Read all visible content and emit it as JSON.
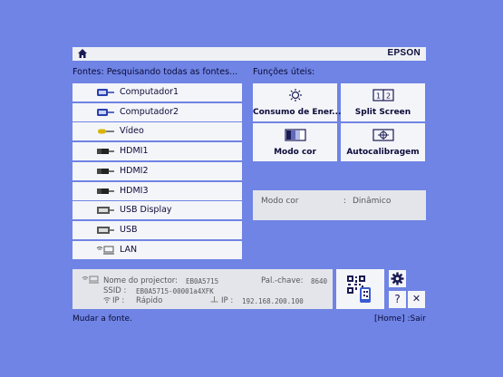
{
  "topbar": {
    "home_icon": "home-icon",
    "brand": "EPSON"
  },
  "sources_header": "Fontes:  Pesquisando todas as fontes...",
  "functions_header": "Funções úteis:",
  "sources": [
    {
      "label": "Computador1",
      "icon": "computer-input-icon"
    },
    {
      "label": "Computador2",
      "icon": "computer-input-icon"
    },
    {
      "label": "Vídeo",
      "icon": "video-input-icon"
    },
    {
      "label": "HDMI1",
      "icon": "hdmi-icon"
    },
    {
      "label": "HDMI2",
      "icon": "hdmi-icon"
    },
    {
      "label": "HDMI3",
      "icon": "hdmi-icon"
    },
    {
      "label": "USB Display",
      "icon": "usb-display-icon"
    },
    {
      "label": "USB",
      "icon": "usb-icon"
    },
    {
      "label": "LAN",
      "icon": "lan-icon"
    }
  ],
  "functions": [
    {
      "label": "Consumo de Ener...",
      "icon": "power-consumption-icon"
    },
    {
      "label": "Split Screen",
      "icon": "split-screen-icon"
    },
    {
      "label": "Modo cor",
      "icon": "color-mode-icon"
    },
    {
      "label": "Autocalibragem",
      "icon": "auto-calibration-icon"
    }
  ],
  "color_mode": {
    "label": "Modo cor",
    "separator": ":",
    "value": "Dinâmico"
  },
  "network": {
    "projector_name_label": "Nome do projector:",
    "projector_name": "EB0A5715",
    "keyword_label": "Pal.-chave:",
    "keyword": "8640",
    "ssid_label": "SSID :",
    "ssid": "EB0A5715-00001a4XFK",
    "ip_mode_label": "IP :",
    "ip_mode": "Rápido",
    "ip_label": "IP :",
    "ip": "192.168.200.100"
  },
  "side_buttons": {
    "qr_icon": "qr-code-icon",
    "settings_icon": "gear-icon",
    "help": "?",
    "close": "✕"
  },
  "footer": {
    "hint": "Mudar a fonte.",
    "home_exit": "[Home] :Sair"
  }
}
